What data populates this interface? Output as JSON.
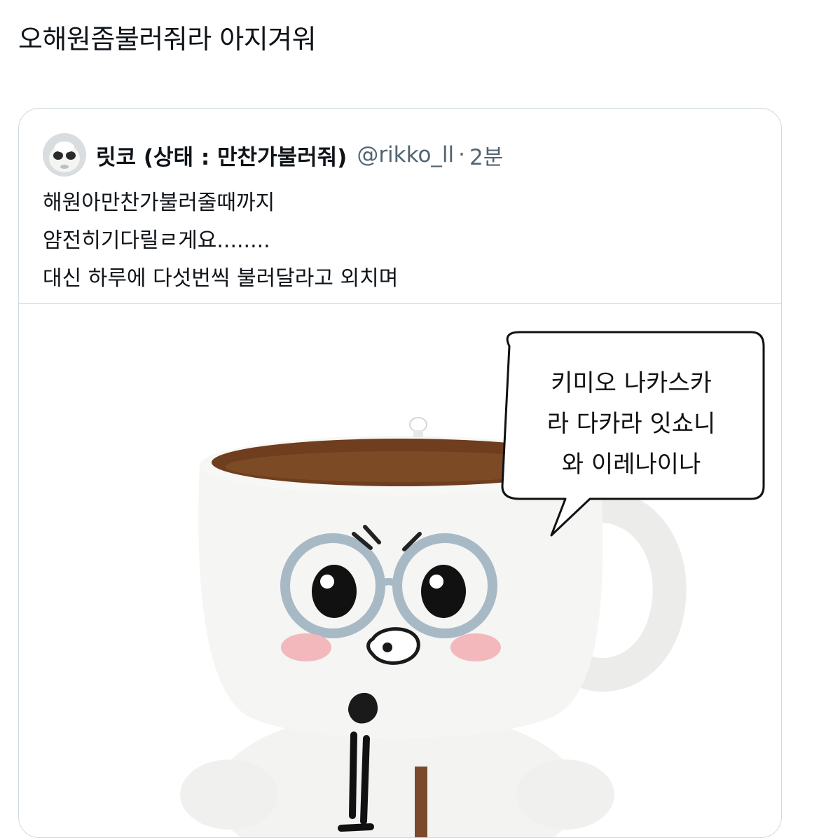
{
  "tweet": {
    "text": "오해원좀불러줘라 아지겨워"
  },
  "quote": {
    "display_name": "릿코 (상태 : 만찬가불러줘)",
    "handle": "@rikko_ll",
    "separator": "·",
    "time": "2분",
    "body_lines": [
      "해원아만찬가불러줄때까지",
      "얌전히기다릴ㄹ게요........",
      "대신 하루에 다섯번씩 불러달라고 외치며"
    ],
    "media": {
      "speech_bubble_lines": [
        "키미오 나카스카",
        "라 다카라 잇쇼니",
        "와 이레나이나"
      ]
    }
  }
}
